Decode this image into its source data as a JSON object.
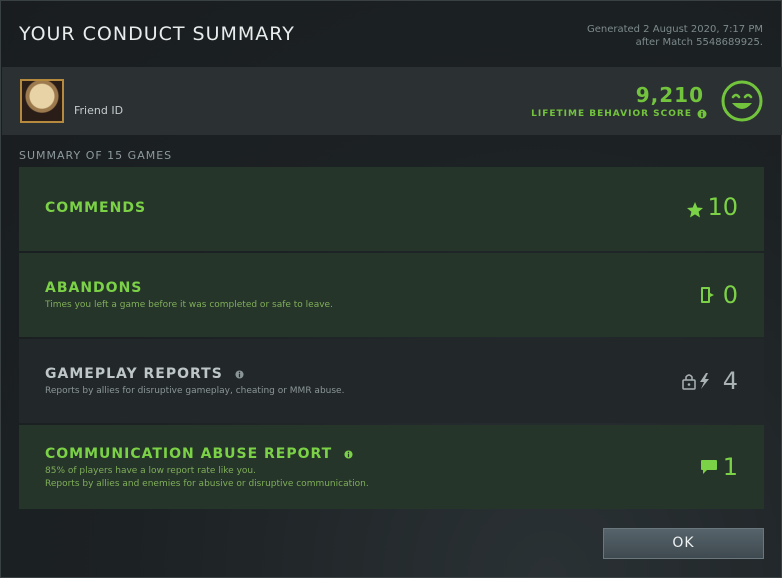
{
  "header": {
    "title": "YOUR CONDUCT SUMMARY",
    "generated_line1": "Generated 2 August 2020, 7:17 PM",
    "generated_line2": "after Match 5548689925."
  },
  "profile": {
    "friend_id_label": "Friend ID",
    "behavior_score": "9,210",
    "behavior_score_label": "LIFETIME BEHAVIOR SCORE",
    "score_face": "smiley-face-icon"
  },
  "summary": {
    "heading": "SUMMARY OF 15 GAMES",
    "cards": [
      {
        "title": "COMMENDS",
        "subtitle": "",
        "value": "10",
        "icon": "star-icon",
        "tone": "green"
      },
      {
        "title": "ABANDONS",
        "subtitle": "Times you left a game before it was completed or safe to leave.",
        "value": "0",
        "icon": "leave-door-icon",
        "tone": "green"
      },
      {
        "title": "GAMEPLAY REPORTS",
        "subtitle": "Reports by allies for disruptive gameplay, cheating or MMR abuse.",
        "value": "4",
        "icon": "lock-lightning-icon",
        "tone": "grey"
      },
      {
        "title": "COMMUNICATION ABUSE REPORT",
        "subtitle_line1": "85% of players have a low report rate like you.",
        "subtitle_line2": "Reports by allies and enemies for abusive or disruptive communication.",
        "value": "1",
        "icon": "chat-bubble-icon",
        "tone": "green"
      }
    ]
  },
  "footer": {
    "ok_label": "OK"
  },
  "colors": {
    "accent_green": "#73c43d",
    "card_green": "#26352a",
    "card_grey": "#22282a"
  }
}
